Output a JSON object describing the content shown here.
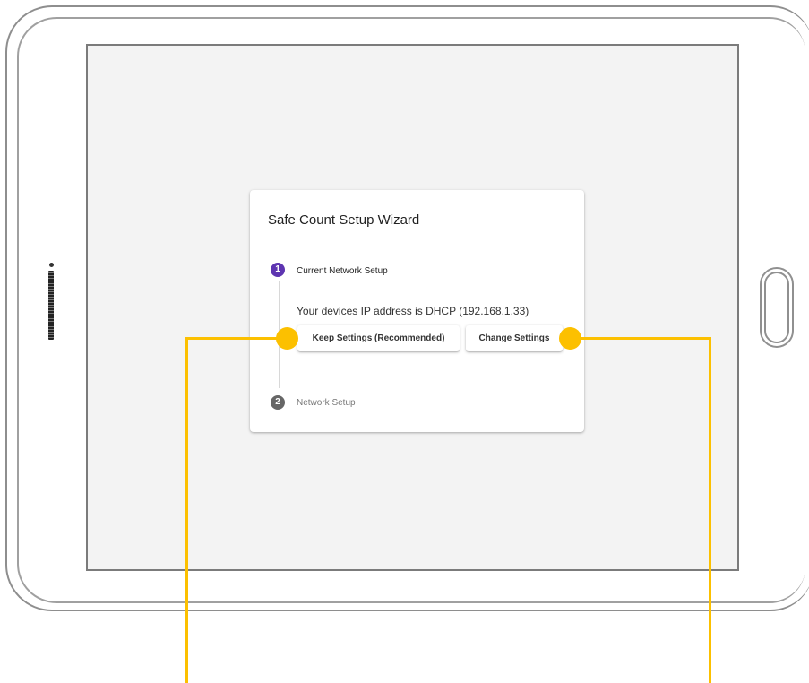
{
  "wizard": {
    "title": "Safe Count Setup Wizard",
    "steps": [
      {
        "number": "1",
        "label": "Current Network Setup",
        "state": "active",
        "message": "Your devices IP address is DHCP (192.168.1.33)",
        "buttons": [
          {
            "label": "Keep Settings (Recommended)"
          },
          {
            "label": "Change Settings"
          }
        ]
      },
      {
        "number": "2",
        "label": "Network Setup",
        "state": "inactive"
      }
    ]
  },
  "colors": {
    "active_step": "#5e35b1",
    "inactive_step": "#666666",
    "callout": "#fcc000",
    "screen_background": "#f3f3f3"
  }
}
